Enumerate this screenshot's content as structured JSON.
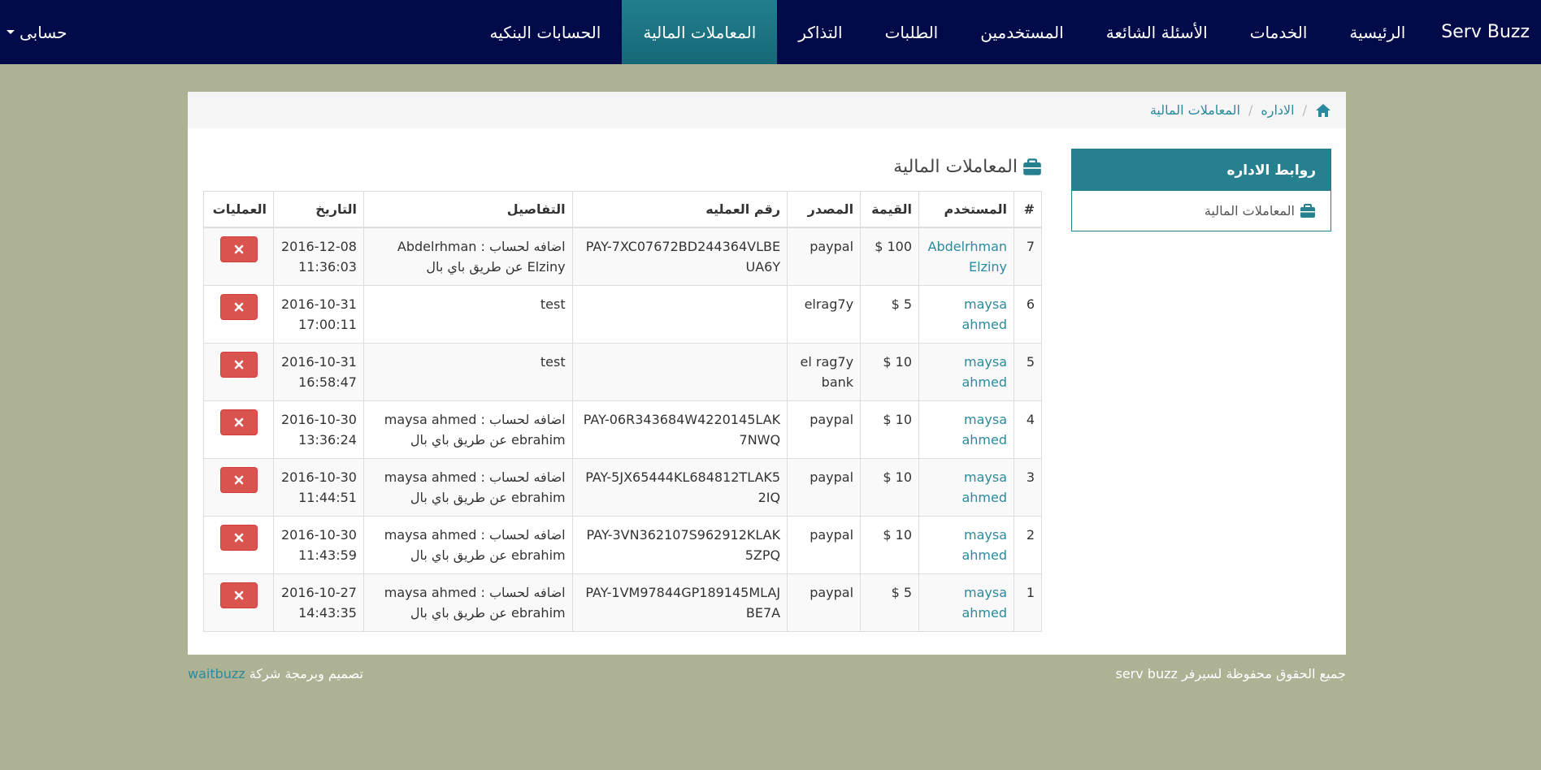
{
  "navbar": {
    "brand": "Serv Buzz",
    "items": [
      {
        "label": "الرئيسية",
        "active": false
      },
      {
        "label": "الخدمات",
        "active": false
      },
      {
        "label": "الأسئلة الشائعة",
        "active": false
      },
      {
        "label": "المستخدمين",
        "active": false
      },
      {
        "label": "الطلبات",
        "active": false
      },
      {
        "label": "التذاكر",
        "active": false
      },
      {
        "label": "المعاملات المالية",
        "active": true
      },
      {
        "label": "الحسابات البنكيه",
        "active": false
      }
    ],
    "account_label": "حسابى"
  },
  "breadcrumb": {
    "home_icon": "home-icon",
    "items": [
      "الاداره",
      "المعاملات المالية"
    ]
  },
  "sidebar": {
    "title": "روابط الاداره",
    "items": [
      {
        "label": "المعاملات المالية",
        "icon": "briefcase-icon"
      }
    ]
  },
  "main": {
    "title": "المعاملات المالية",
    "title_icon": "briefcase-icon"
  },
  "table": {
    "headers": [
      "#",
      "المستخدم",
      "القيمة",
      "المصدر",
      "رقم العمليه",
      "التفاصيل",
      "التاريخ",
      "العمليات"
    ],
    "rows": [
      {
        "id": "7",
        "user": "Abdelrhman Elziny",
        "amount": "$ 100",
        "source": "paypal",
        "txn": "PAY-7XC07672BD244364VLBEUA6Y",
        "details": "اضافه لحساب : Abdelrhman Elziny عن طريق باي بال",
        "date": "2016-12-08",
        "time": "11:36:03"
      },
      {
        "id": "6",
        "user": "maysa ahmed",
        "amount": "$ 5",
        "source": "elrag7y",
        "txn": "",
        "details": "test",
        "date": "2016-10-31",
        "time": "17:00:11"
      },
      {
        "id": "5",
        "user": "maysa ahmed",
        "amount": "$ 10",
        "source": "el rag7y bank",
        "txn": "",
        "details": "test",
        "date": "2016-10-31",
        "time": "16:58:47"
      },
      {
        "id": "4",
        "user": "maysa ahmed",
        "amount": "$ 10",
        "source": "paypal",
        "txn": "PAY-06R343684W4220145LAK7NWQ",
        "details": "اضافه لحساب : maysa ahmed ebrahim عن طريق باي بال",
        "date": "2016-10-30",
        "time": "13:36:24"
      },
      {
        "id": "3",
        "user": "maysa ahmed",
        "amount": "$ 10",
        "source": "paypal",
        "txn": "PAY-5JX65444KL684812TLAK52IQ",
        "details": "اضافه لحساب : maysa ahmed ebrahim عن طريق باي بال",
        "date": "2016-10-30",
        "time": "11:44:51"
      },
      {
        "id": "2",
        "user": "maysa ahmed",
        "amount": "$ 10",
        "source": "paypal",
        "txn": "PAY-3VN362107S962912KLAK5ZPQ",
        "details": "اضافه لحساب : maysa ahmed ebrahim عن طريق باي بال",
        "date": "2016-10-30",
        "time": "11:43:59"
      },
      {
        "id": "1",
        "user": "maysa ahmed",
        "amount": "$ 5",
        "source": "paypal",
        "txn": "PAY-1VM97844GP189145MLAJBE7A",
        "details": "اضافه لحساب : maysa ahmed ebrahim عن طريق باي بال",
        "date": "2016-10-27",
        "time": "14:43:35"
      }
    ],
    "delete_icon": "close-icon"
  },
  "footer": {
    "rights": "جميع الحقوق محفوظة لسيرفر serv buzz",
    "design_prefix": "تصميم وبرمجة شركة",
    "company": "waitbuzz"
  },
  "colors": {
    "navbar_bg": "#030a4a",
    "active_tab": "#1d7584",
    "accent": "#26808f",
    "page_bg": "#aeb295",
    "danger": "#d9534f"
  }
}
